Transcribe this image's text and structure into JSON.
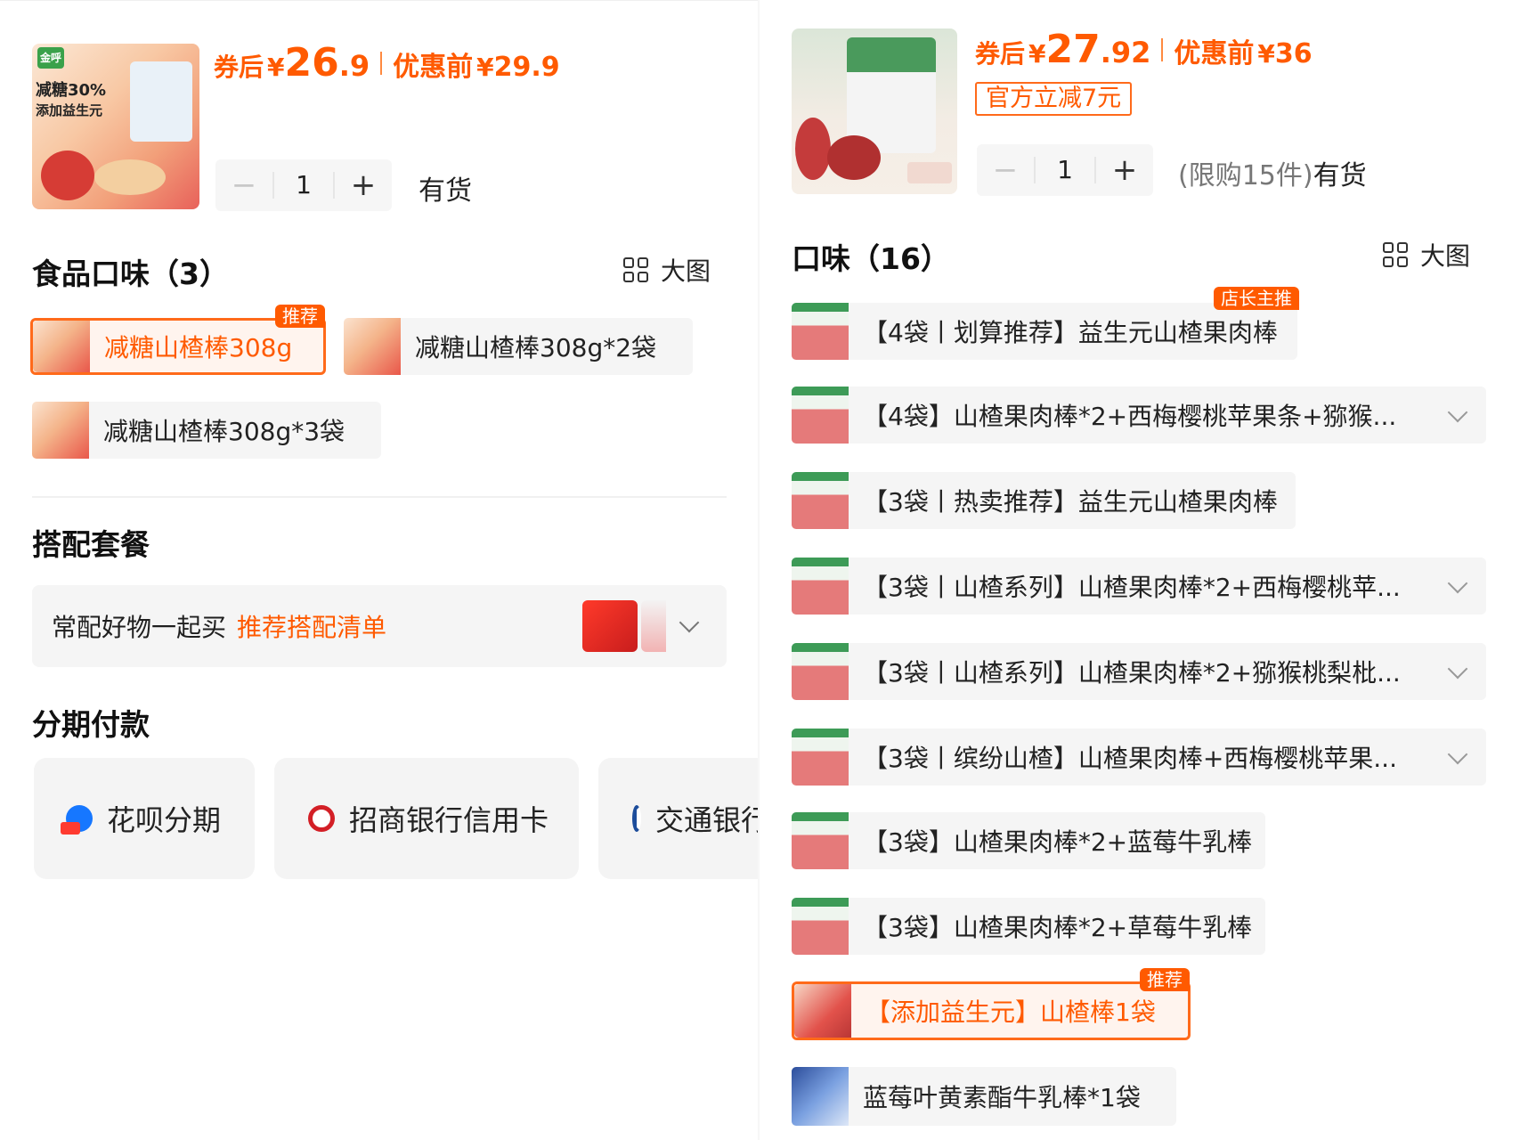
{
  "left": {
    "product": {
      "price_after_label": "券后",
      "currency": "¥",
      "price_after_int": "26",
      "price_after_dec": ".9",
      "price_before_label": "优惠前",
      "price_before": "29.9",
      "thumb_brand": "金呼",
      "thumb_text_1": "减糖30%",
      "thumb_text_2": "添加益生元",
      "quantity": "1",
      "minus": "−",
      "plus": "+",
      "stock": "有货"
    },
    "flavors": {
      "title": "食品口味（3）",
      "view_label": "大图",
      "items": [
        {
          "label": "减糖山楂棒308g",
          "badge": "推荐"
        },
        {
          "label": "减糖山楂棒308g*2袋"
        },
        {
          "label": "减糖山楂棒308g*3袋"
        }
      ]
    },
    "bundle": {
      "title": "搭配套餐",
      "text": "常配好物一起买",
      "link": "推荐搭配清单"
    },
    "installment": {
      "title": "分期付款",
      "options": [
        {
          "label": "花呗分期",
          "icon": "huabei-icon"
        },
        {
          "label": "招商银行信用卡",
          "icon": "cmb-bank-icon"
        },
        {
          "label": "交通银行信用卡",
          "icon": "bocom-bank-icon"
        }
      ]
    }
  },
  "right": {
    "product": {
      "price_after_label": "券后",
      "currency": "¥",
      "price_after_int": "27",
      "price_after_dec": ".92",
      "price_before_label": "优惠前",
      "price_before": "36",
      "discount_tag": "官方立减7元",
      "quantity": "1",
      "minus": "−",
      "plus": "+",
      "limit": "(限购15件)",
      "stock": "有货"
    },
    "flavors": {
      "title": "口味（16）",
      "view_label": "大图",
      "items": [
        {
          "label": "【4袋丨划算推荐】益生元山楂果肉棒",
          "badge": "店长主推"
        },
        {
          "label": "【4袋】山楂果肉棒*2+西梅樱桃苹果条+猕猴..."
        },
        {
          "label": "【3袋丨热卖推荐】益生元山楂果肉棒"
        },
        {
          "label": "【3袋丨山楂系列】山楂果肉棒*2+西梅樱桃苹..."
        },
        {
          "label": "【3袋丨山楂系列】山楂果肉棒*2+猕猴桃梨枇..."
        },
        {
          "label": "【3袋丨缤纷山楂】山楂果肉棒+西梅樱桃苹果..."
        },
        {
          "label": "【3袋】山楂果肉棒*2+蓝莓牛乳棒"
        },
        {
          "label": "【3袋】山楂果肉棒*2+草莓牛乳棒"
        },
        {
          "label": "【添加益生元】山楂棒1袋",
          "badge": "推荐"
        },
        {
          "label": "蓝莓叶黄素酯牛乳棒*1袋"
        }
      ]
    }
  },
  "colors": {
    "accent": "#ff5a00",
    "chip_bg": "#f5f5f5",
    "selected_bg": "#fff4ee"
  }
}
